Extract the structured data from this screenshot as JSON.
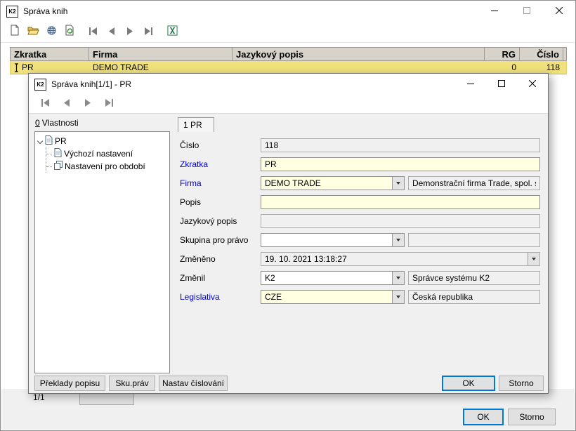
{
  "logo": "K2",
  "colors": {
    "selected_row": "#F0E17C",
    "edit_field_bg": "#FFFFE1",
    "readonly_field_bg": "#F0F0F0",
    "required_label_blue": "#0000D4",
    "default_button_border": "#0078D7"
  },
  "main_window": {
    "title": "Správa knih",
    "toolbar_icons": [
      "new-document",
      "open-folder",
      "globe",
      "refresh-document",
      "first-record",
      "previous-record",
      "next-record",
      "last-record",
      "excel-export"
    ],
    "table": {
      "columns": [
        "Zkratka",
        "Firma",
        "Jazykový popis",
        "RG",
        "Číslo"
      ],
      "rows": [
        {
          "zkratka": "PR",
          "firma": "DEMO TRADE",
          "jazykovy_popis": "",
          "rg": "0",
          "cislo": "118"
        }
      ]
    },
    "record_counter": "1/1",
    "ok_button": "OK",
    "storno_button": "Storno"
  },
  "dialog": {
    "title": "Správa knih[1/1] - PR",
    "toolbar_icons": [
      "first-record",
      "previous-record",
      "next-record",
      "last-record"
    ],
    "properties_header": {
      "accel": "0",
      "text": "Vlastnosti"
    },
    "tree": {
      "root": "PR",
      "children": [
        "Výchozí nastavení",
        "Nastavení pro období"
      ]
    },
    "tab": "1 PR",
    "fields": [
      {
        "label": "Číslo",
        "value": "118"
      },
      {
        "label": "Zkratka",
        "value": "PR"
      },
      {
        "label": "Firma",
        "value": "DEMO TRADE",
        "value2": "Demonstrační firma Trade, spol. s r.o."
      },
      {
        "label": "Popis",
        "value": ""
      },
      {
        "label": "Jazykový popis",
        "value": ""
      },
      {
        "label": "Skupina pro právo",
        "value": "",
        "value2": ""
      },
      {
        "label": "Změněno",
        "value": "19. 10. 2021 13:18:27"
      },
      {
        "label": "Změnil",
        "value": "K2",
        "value2": "Správce systému K2"
      },
      {
        "label": "Legislativa",
        "value": "CZE",
        "value2": "Česká republika"
      }
    ],
    "buttons": {
      "preklady": "Překlady popisu",
      "sku_prav": "Sku.práv",
      "nastav_cislovani": "Nastav číslování",
      "ok": "OK",
      "storno": "Storno"
    }
  }
}
